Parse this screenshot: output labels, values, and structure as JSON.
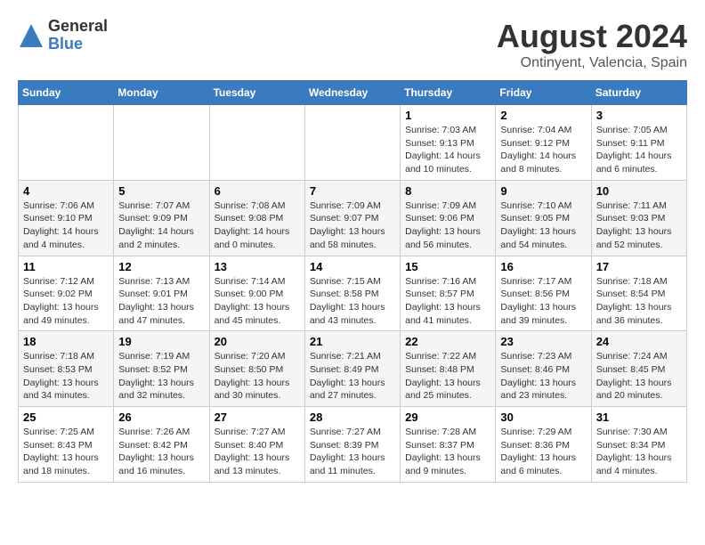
{
  "logo": {
    "general": "General",
    "blue": "Blue"
  },
  "title": "August 2024",
  "subtitle": "Ontinyent, Valencia, Spain",
  "days_of_week": [
    "Sunday",
    "Monday",
    "Tuesday",
    "Wednesday",
    "Thursday",
    "Friday",
    "Saturday"
  ],
  "weeks": [
    {
      "days": [
        {
          "num": "",
          "info": ""
        },
        {
          "num": "",
          "info": ""
        },
        {
          "num": "",
          "info": ""
        },
        {
          "num": "",
          "info": ""
        },
        {
          "num": "1",
          "info": "Sunrise: 7:03 AM\nSunset: 9:13 PM\nDaylight: 14 hours\nand 10 minutes."
        },
        {
          "num": "2",
          "info": "Sunrise: 7:04 AM\nSunset: 9:12 PM\nDaylight: 14 hours\nand 8 minutes."
        },
        {
          "num": "3",
          "info": "Sunrise: 7:05 AM\nSunset: 9:11 PM\nDaylight: 14 hours\nand 6 minutes."
        }
      ]
    },
    {
      "days": [
        {
          "num": "4",
          "info": "Sunrise: 7:06 AM\nSunset: 9:10 PM\nDaylight: 14 hours\nand 4 minutes."
        },
        {
          "num": "5",
          "info": "Sunrise: 7:07 AM\nSunset: 9:09 PM\nDaylight: 14 hours\nand 2 minutes."
        },
        {
          "num": "6",
          "info": "Sunrise: 7:08 AM\nSunset: 9:08 PM\nDaylight: 14 hours\nand 0 minutes."
        },
        {
          "num": "7",
          "info": "Sunrise: 7:09 AM\nSunset: 9:07 PM\nDaylight: 13 hours\nand 58 minutes."
        },
        {
          "num": "8",
          "info": "Sunrise: 7:09 AM\nSunset: 9:06 PM\nDaylight: 13 hours\nand 56 minutes."
        },
        {
          "num": "9",
          "info": "Sunrise: 7:10 AM\nSunset: 9:05 PM\nDaylight: 13 hours\nand 54 minutes."
        },
        {
          "num": "10",
          "info": "Sunrise: 7:11 AM\nSunset: 9:03 PM\nDaylight: 13 hours\nand 52 minutes."
        }
      ]
    },
    {
      "days": [
        {
          "num": "11",
          "info": "Sunrise: 7:12 AM\nSunset: 9:02 PM\nDaylight: 13 hours\nand 49 minutes."
        },
        {
          "num": "12",
          "info": "Sunrise: 7:13 AM\nSunset: 9:01 PM\nDaylight: 13 hours\nand 47 minutes."
        },
        {
          "num": "13",
          "info": "Sunrise: 7:14 AM\nSunset: 9:00 PM\nDaylight: 13 hours\nand 45 minutes."
        },
        {
          "num": "14",
          "info": "Sunrise: 7:15 AM\nSunset: 8:58 PM\nDaylight: 13 hours\nand 43 minutes."
        },
        {
          "num": "15",
          "info": "Sunrise: 7:16 AM\nSunset: 8:57 PM\nDaylight: 13 hours\nand 41 minutes."
        },
        {
          "num": "16",
          "info": "Sunrise: 7:17 AM\nSunset: 8:56 PM\nDaylight: 13 hours\nand 39 minutes."
        },
        {
          "num": "17",
          "info": "Sunrise: 7:18 AM\nSunset: 8:54 PM\nDaylight: 13 hours\nand 36 minutes."
        }
      ]
    },
    {
      "days": [
        {
          "num": "18",
          "info": "Sunrise: 7:18 AM\nSunset: 8:53 PM\nDaylight: 13 hours\nand 34 minutes."
        },
        {
          "num": "19",
          "info": "Sunrise: 7:19 AM\nSunset: 8:52 PM\nDaylight: 13 hours\nand 32 minutes."
        },
        {
          "num": "20",
          "info": "Sunrise: 7:20 AM\nSunset: 8:50 PM\nDaylight: 13 hours\nand 30 minutes."
        },
        {
          "num": "21",
          "info": "Sunrise: 7:21 AM\nSunset: 8:49 PM\nDaylight: 13 hours\nand 27 minutes."
        },
        {
          "num": "22",
          "info": "Sunrise: 7:22 AM\nSunset: 8:48 PM\nDaylight: 13 hours\nand 25 minutes."
        },
        {
          "num": "23",
          "info": "Sunrise: 7:23 AM\nSunset: 8:46 PM\nDaylight: 13 hours\nand 23 minutes."
        },
        {
          "num": "24",
          "info": "Sunrise: 7:24 AM\nSunset: 8:45 PM\nDaylight: 13 hours\nand 20 minutes."
        }
      ]
    },
    {
      "days": [
        {
          "num": "25",
          "info": "Sunrise: 7:25 AM\nSunset: 8:43 PM\nDaylight: 13 hours\nand 18 minutes."
        },
        {
          "num": "26",
          "info": "Sunrise: 7:26 AM\nSunset: 8:42 PM\nDaylight: 13 hours\nand 16 minutes."
        },
        {
          "num": "27",
          "info": "Sunrise: 7:27 AM\nSunset: 8:40 PM\nDaylight: 13 hours\nand 13 minutes."
        },
        {
          "num": "28",
          "info": "Sunrise: 7:27 AM\nSunset: 8:39 PM\nDaylight: 13 hours\nand 11 minutes."
        },
        {
          "num": "29",
          "info": "Sunrise: 7:28 AM\nSunset: 8:37 PM\nDaylight: 13 hours\nand 9 minutes."
        },
        {
          "num": "30",
          "info": "Sunrise: 7:29 AM\nSunset: 8:36 PM\nDaylight: 13 hours\nand 6 minutes."
        },
        {
          "num": "31",
          "info": "Sunrise: 7:30 AM\nSunset: 8:34 PM\nDaylight: 13 hours\nand 4 minutes."
        }
      ]
    }
  ]
}
